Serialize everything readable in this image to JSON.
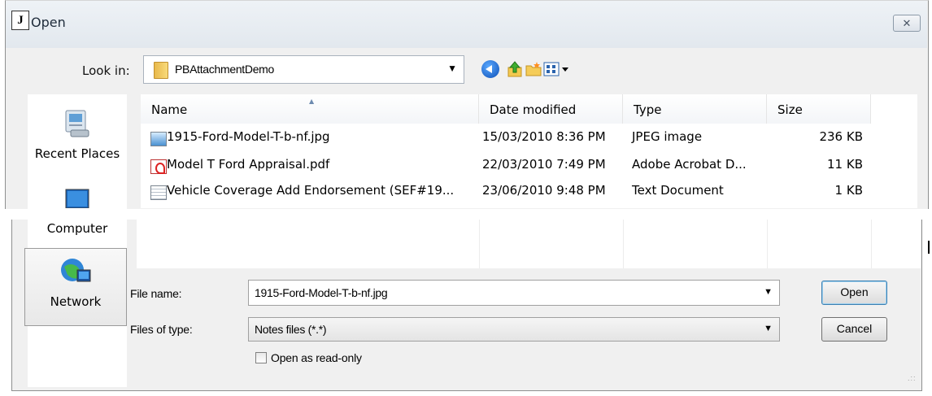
{
  "window": {
    "title": "Open",
    "app_icon_text": "J",
    "close_label": "✕"
  },
  "lookin": {
    "label": "Look in:",
    "value": "PBAttachmentDemo"
  },
  "places": [
    {
      "label": "Recent Places"
    },
    {
      "label": "Computer"
    },
    {
      "label": "Network"
    }
  ],
  "columns": {
    "name": "Name",
    "date": "Date modified",
    "type": "Type",
    "size": "Size"
  },
  "files": [
    {
      "name": "1915-Ford-Model-T-b-nf.jpg",
      "date": "15/03/2010 8:36 PM",
      "type": "JPEG image",
      "size": "236 KB",
      "icon": "jpg-file-icon"
    },
    {
      "name": "Model T Ford Appraisal.pdf",
      "date": "22/03/2010 7:49 PM",
      "type": "Adobe Acrobat D...",
      "size": "11 KB",
      "icon": "pdf-file-icon"
    },
    {
      "name": "Vehicle Coverage Add Endorsement (SEF#19...",
      "date": "23/06/2010 9:48 PM",
      "type": "Text Document",
      "size": "1 KB",
      "icon": "text-file-icon"
    }
  ],
  "form": {
    "filename_label": "File name:",
    "filename_value": "1915-Ford-Model-T-b-nf.jpg",
    "filetype_label": "Files of type:",
    "filetype_value": "Notes files (*.*)",
    "readonly_label": "Open as read-only",
    "readonly_checked": false
  },
  "buttons": {
    "open": "Open",
    "cancel": "Cancel"
  },
  "colors": {
    "window_bg": "#f0f0f0",
    "default_button_border": "#3c7fb1"
  }
}
